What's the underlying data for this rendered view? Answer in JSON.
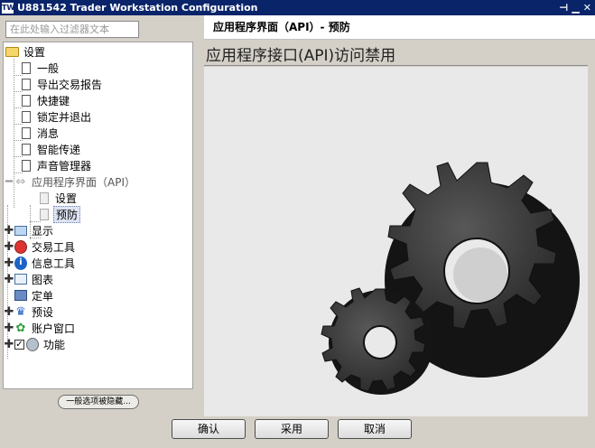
{
  "window": {
    "title": "U881542 Trader Workstation Configuration",
    "app_icon_text": "TWS"
  },
  "filter": {
    "placeholder": "在此处输入过滤器文本"
  },
  "tree": {
    "settings": "设置",
    "settings_children": [
      "一般",
      "导出交易报告",
      "快捷键",
      "锁定并退出",
      "消息",
      "智能传递",
      "声音管理器"
    ],
    "api": "应用程序界面（API）",
    "api_children": [
      "设置",
      "预防"
    ],
    "display": "显示",
    "trading_tools": "交易工具",
    "info_tools": "信息工具",
    "charts": "图表",
    "orders": "定单",
    "presets": "预设",
    "account_window": "账户窗口",
    "features": "功能"
  },
  "hide_button": "一般选项被隐藏...",
  "panel": {
    "header": "应用程序界面（API）- 预防",
    "heading": "应用程序接口(API)访问禁用"
  },
  "buttons": {
    "ok": "确认",
    "apply": "采用",
    "cancel": "取消"
  },
  "colors": {
    "titlebar": "#0a246a",
    "selection": "#dde4f3"
  }
}
